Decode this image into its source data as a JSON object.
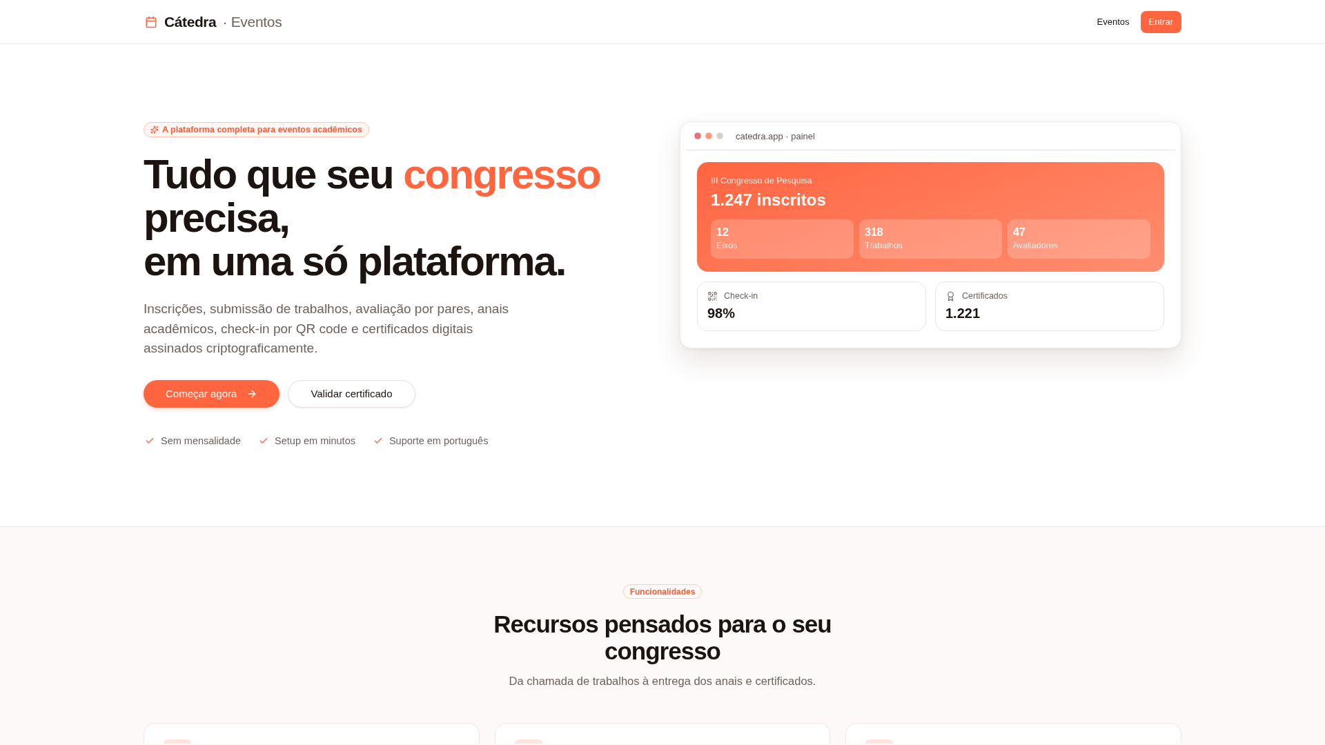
{
  "header": {
    "brand": "Cátedra",
    "brand_suffix": "· Eventos",
    "nav": [
      {
        "label": "Eventos",
        "kind": "link"
      },
      {
        "label": "Entrar",
        "kind": "button"
      }
    ]
  },
  "hero": {
    "badge": "A plataforma completa para eventos acadêmicos",
    "headline": [
      {
        "parts": [
          {
            "text": "Tudo que seu ",
            "accent": false
          },
          {
            "text": "congresso",
            "accent": true
          },
          {
            "text": " precisa,",
            "accent": false
          }
        ]
      },
      {
        "parts": [
          {
            "text": "em uma só plataforma.",
            "accent": false
          }
        ]
      }
    ],
    "description": "Inscrições, submissão de trabalhos, avaliação por pares, anais acadêmicos, check-in por QR code e certificados digitais assinados criptograficamente.",
    "actions": [
      {
        "label": "Começar agora",
        "kind": "primary"
      },
      {
        "label": "Validar certificado",
        "kind": "secondary"
      }
    ],
    "perks": [
      "Sem mensalidade",
      "Setup em minutos",
      "Suporte em português"
    ]
  },
  "dashboard": {
    "address": "catedra.app · painel",
    "event": {
      "name": "III Congresso de Pesquisa",
      "registrations": "1.247 inscritos",
      "stats": [
        {
          "value": "12",
          "label": "Eixos"
        },
        {
          "value": "318",
          "label": "Trabalhos"
        },
        {
          "value": "47",
          "label": "Avaliadores"
        }
      ]
    },
    "metrics": [
      {
        "label": "Check-in",
        "value": "98%"
      },
      {
        "label": "Certificados",
        "value": "1.221"
      }
    ]
  },
  "features": {
    "badge": "Funcionalidades",
    "title": "Recursos pensados para o seu congresso",
    "subtitle": "Da chamada de trabalhos à entrega dos anais e certificados.",
    "cards": [
      {
        "kind": "feature"
      },
      {
        "kind": "feature"
      },
      {
        "kind": "feature"
      }
    ]
  }
}
